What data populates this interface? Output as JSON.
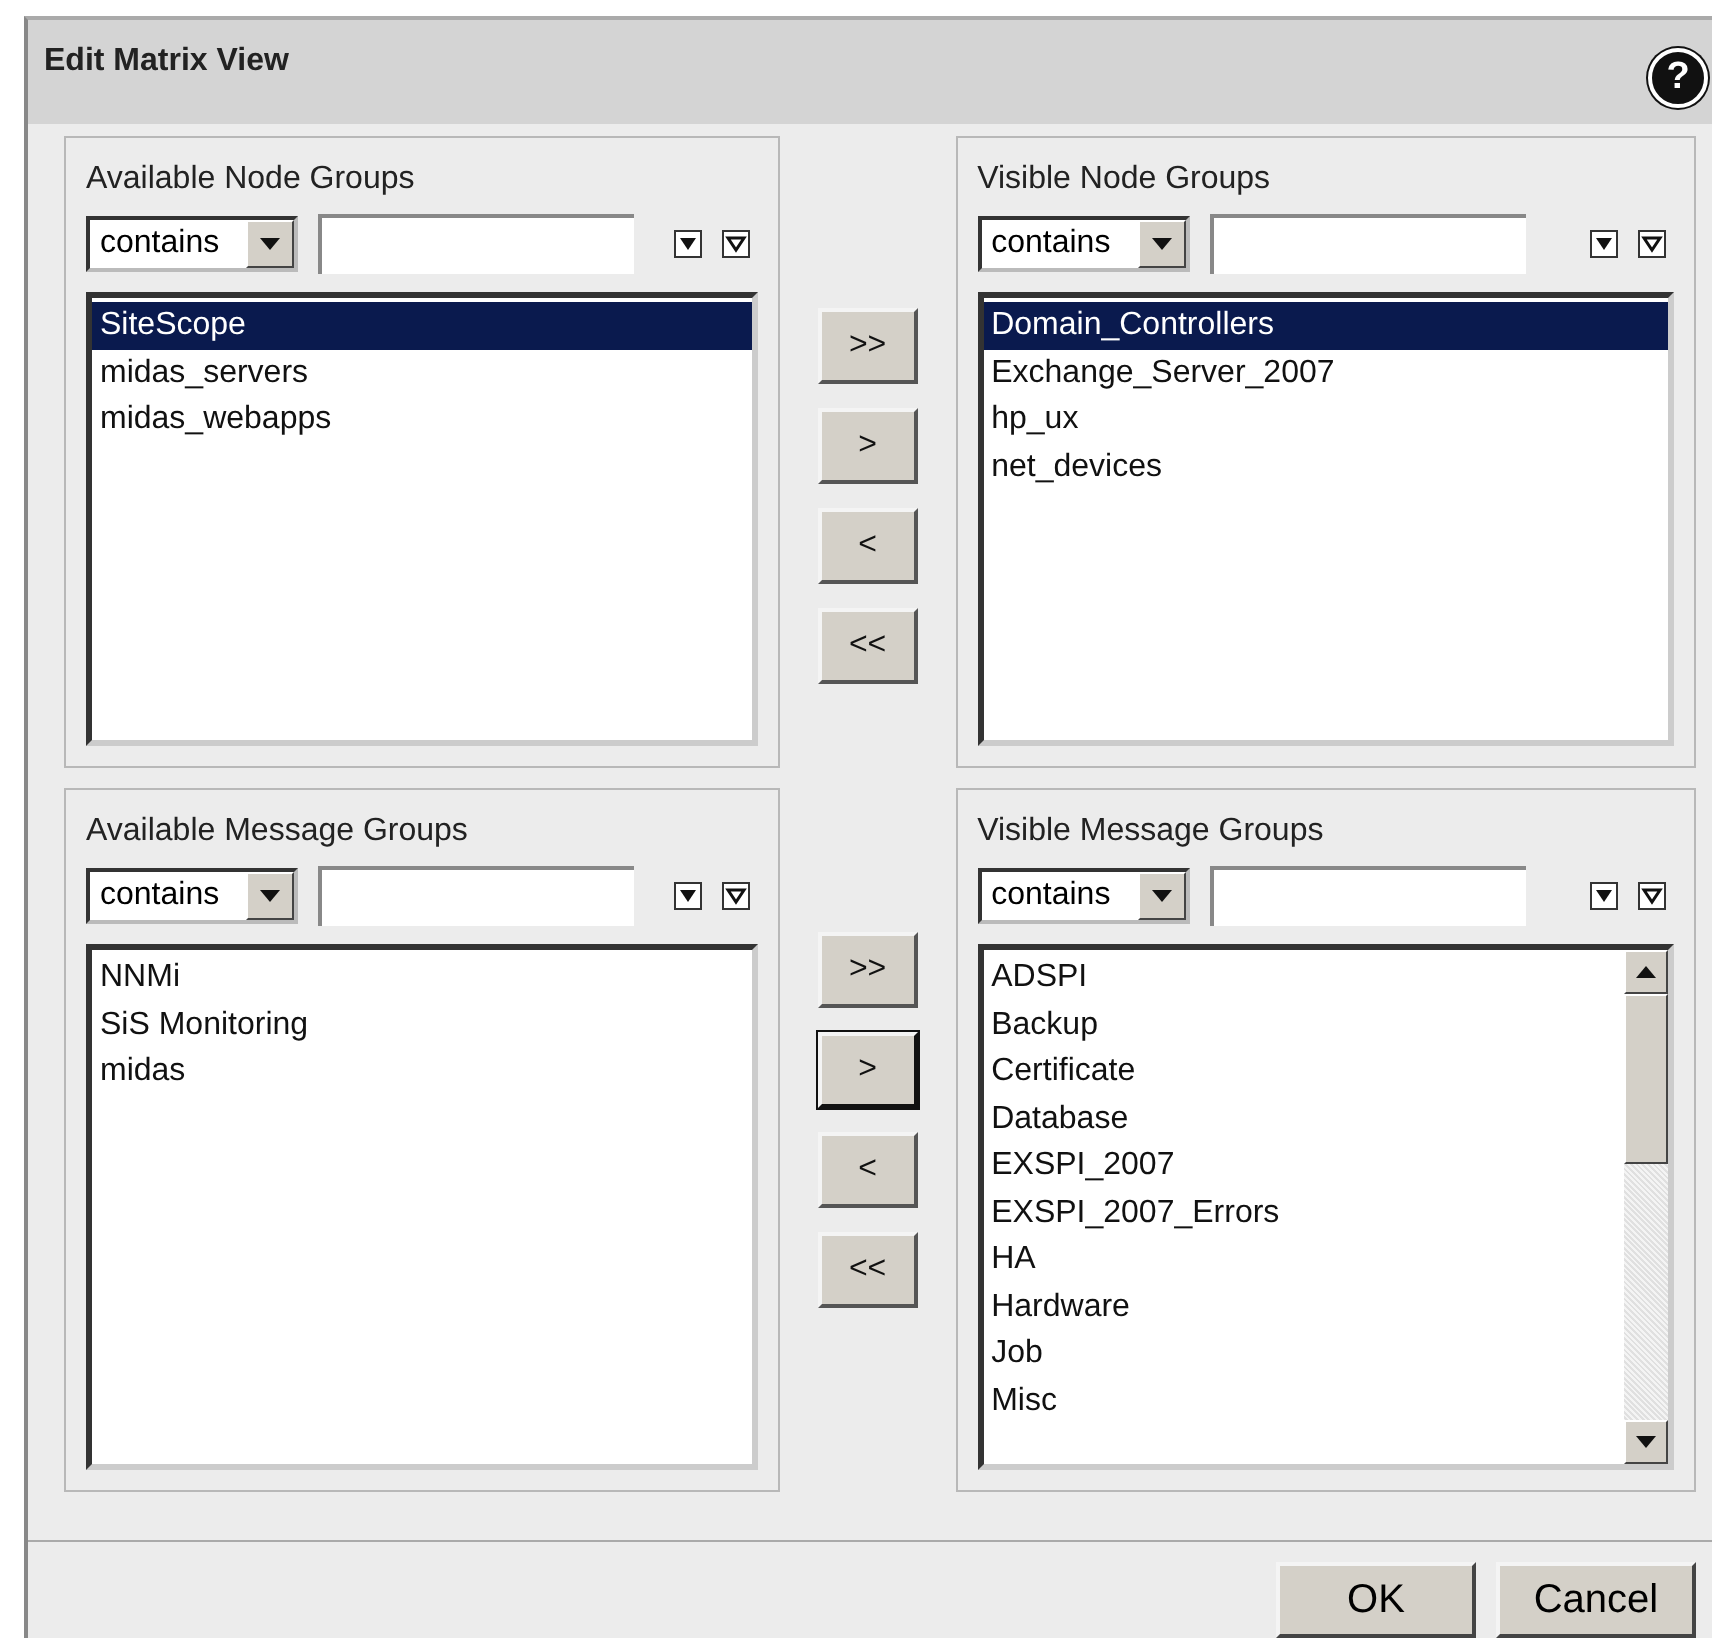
{
  "window": {
    "title": "Edit Matrix View",
    "help": "?"
  },
  "sections": [
    {
      "left": {
        "title": "Available Node Groups",
        "operator": "contains",
        "items": [
          {
            "label": "SiteScope",
            "selected": true
          },
          {
            "label": "midas_servers",
            "selected": false
          },
          {
            "label": "midas_webapps",
            "selected": false
          }
        ]
      },
      "right": {
        "title": "Visible Node Groups",
        "operator": "contains",
        "scrollbar": false,
        "items": [
          {
            "label": "Domain_Controllers",
            "selected": true
          },
          {
            "label": "Exchange_Server_2007",
            "selected": false
          },
          {
            "label": "hp_ux",
            "selected": false
          },
          {
            "label": "net_devices",
            "selected": false
          }
        ]
      },
      "buttons": [
        {
          "label": ">>",
          "focused": false
        },
        {
          "label": ">",
          "focused": false
        },
        {
          "label": "<",
          "focused": false
        },
        {
          "label": "<<",
          "focused": false
        }
      ]
    },
    {
      "left": {
        "title": "Available Message Groups",
        "operator": "contains",
        "items": [
          {
            "label": "NNMi",
            "selected": false
          },
          {
            "label": "SiS Monitoring",
            "selected": false
          },
          {
            "label": "midas",
            "selected": false
          }
        ]
      },
      "right": {
        "title": "Visible Message Groups",
        "operator": "contains",
        "scrollbar": true,
        "items": [
          {
            "label": "ADSPI",
            "selected": false
          },
          {
            "label": "Backup",
            "selected": false
          },
          {
            "label": "Certificate",
            "selected": false
          },
          {
            "label": "Database",
            "selected": false
          },
          {
            "label": "EXSPI_2007",
            "selected": false
          },
          {
            "label": "EXSPI_2007_Errors",
            "selected": false
          },
          {
            "label": "HA",
            "selected": false
          },
          {
            "label": "Hardware",
            "selected": false
          },
          {
            "label": "Job",
            "selected": false
          },
          {
            "label": "Misc",
            "selected": false
          }
        ]
      },
      "buttons": [
        {
          "label": ">>",
          "focused": false
        },
        {
          "label": ">",
          "focused": true
        },
        {
          "label": "<",
          "focused": false
        },
        {
          "label": "<<",
          "focused": false
        }
      ]
    }
  ],
  "footer": {
    "buttons": [
      {
        "label": "OK"
      },
      {
        "label": "Cancel"
      }
    ]
  }
}
